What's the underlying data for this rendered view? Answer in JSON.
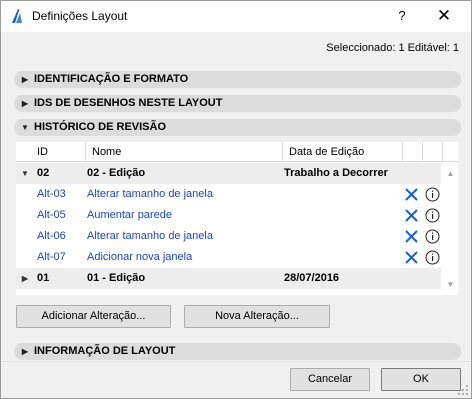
{
  "window": {
    "title": "Definições Layout",
    "help_label": "?",
    "close_label": "✕"
  },
  "selection_info": "Seleccionado: 1 Editável: 1",
  "sections": {
    "identification": {
      "label": "IDENTIFICAÇÃO E FORMATO",
      "expanded": false
    },
    "drawing_ids": {
      "label": "IDS DE DESENHOS NESTE LAYOUT",
      "expanded": false
    },
    "revision_history": {
      "label": "HISTÓRICO DE REVISÃO",
      "expanded": true
    },
    "layout_info": {
      "label": "INFORMAÇÃO DE LAYOUT",
      "expanded": false
    }
  },
  "revision_table": {
    "columns": [
      "ID",
      "Nome",
      "Data de Edição"
    ],
    "groups": [
      {
        "id": "02",
        "name": "02 - Edição",
        "date": "Trabalho a Decorrer",
        "expanded": true,
        "changes": [
          {
            "id": "Alt-03",
            "name": "Alterar tamanho de janela"
          },
          {
            "id": "Alt-05",
            "name": "Aumentar parede"
          },
          {
            "id": "Alt-06",
            "name": "Alterar tamanho de janela"
          },
          {
            "id": "Alt-07",
            "name": "Adicionar nova janela"
          }
        ]
      },
      {
        "id": "01",
        "name": "01 - Edição",
        "date": "28/07/2016",
        "expanded": false,
        "changes": []
      }
    ]
  },
  "buttons": {
    "add_change": "Adicionar Alteração...",
    "new_change": "Nova Alteração...",
    "cancel": "Cancelar",
    "ok": "OK"
  },
  "colors": {
    "link": "#1a44c4",
    "remove_icon": "#1a5fd6",
    "section_bg": "#dcdcdc",
    "dialog_bg": "#f0f0f0"
  },
  "icons": {
    "app": "archicad-logo-icon",
    "remove": "remove-x-icon",
    "info": "info-icon",
    "collapsed": "triangle-right-icon",
    "expanded": "triangle-down-icon"
  }
}
